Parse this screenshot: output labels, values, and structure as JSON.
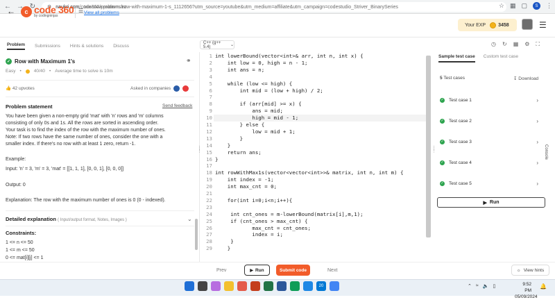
{
  "browser": {
    "url_host": "naukri.com",
    "url_path": "/code360/problems/row-with-maximum-1-s_1112656?utm_source=youtube&utm_medium=affiliate&utm_campaign=codestudio_Striver_BinarySeries",
    "profile_initial": "S"
  },
  "header": {
    "logo_main": "code 360",
    "logo_sub": "by codingninjas",
    "list_label": "Interview problem list",
    "list_link": "View all problems",
    "exp_label": "Your EXP",
    "exp_value": "3458"
  },
  "left_tabs": [
    "Problem",
    "Submissions",
    "Hints & solutions",
    "Discuss"
  ],
  "problem": {
    "title": "Row with Maximum 1's",
    "difficulty": "Easy",
    "score": "40/40",
    "avg_time": "Average time to solve is 10m",
    "upvotes": "42 upvotes",
    "asked_in": "Asked in companies",
    "statement_heading": "Problem statement",
    "feedback": "Send feedback",
    "statement_lines": [
      "You have been given a non-empty grid 'mat' with 'n' rows and 'm' columns",
      "consisting of only 0s and 1s. All the rows are sorted in ascending order.",
      "Your task is to find the index of the row with the maximum number of ones.",
      "Note: If two rows have the same number of ones, consider the one with a",
      "smaller index. If there's no row with at least 1 zero, return -1."
    ],
    "example_label": "Example:",
    "input": "Input: 'n' = 3, 'm' = 3, 'mat' = [[1, 1, 1], [0, 0, 1], [0, 0, 0]]",
    "output": "Output: 0",
    "explanation": "Explanation: The row with the maximum number of ones is 0 (0 - indexed).",
    "detailed_heading": "Detailed explanation",
    "detailed_sub": "( Input/output format, Notes, Images )",
    "constraints_heading": "Constraints:",
    "constraints": [
      "1 <= n <= 50",
      "1 <= m <= 50",
      "0 <= mat[i][j] <= 1"
    ]
  },
  "editor": {
    "language": "C++ (g++ 5.4)",
    "lines": [
      "int lowerBound(vector<int>& arr, int n, int x) {",
      "    int low = 0, high = n - 1;",
      "    int ans = n;",
      "",
      "    while (low <= high) {",
      "        int mid = (low + high) / 2;",
      "",
      "        if (arr[mid] >= x) {",
      "            ans = mid;",
      "            high = mid - 1;",
      "        } else {",
      "            low = mid + 1;",
      "        }",
      "    }",
      "    return ans;",
      "}",
      "",
      "int rowWithMax1s(vector<vector<int>>& matrix, int n, int m) {",
      "    int index = -1;",
      "    int max_cnt = 0;",
      "",
      "    for(int i=0;i<n;i++){",
      "",
      "     int cnt_ones = m-lowerBound(matrix[i],m,1);",
      "     if (cnt_ones > max_cnt) {",
      "            max_cnt = cnt_ones;",
      "            index = i;",
      "     }",
      "    }"
    ]
  },
  "right_panel": {
    "tabs": [
      "Sample test case",
      "Custom test case"
    ],
    "count_num": "5",
    "count_label": "Test cases",
    "download": "Download",
    "test_cases": [
      "Test case 1",
      "Test case 2",
      "Test case 3",
      "Test case 4",
      "Test case 5"
    ],
    "run": "Run",
    "console": "Console"
  },
  "bottom": {
    "prev": "Prev",
    "run": "Run",
    "submit": "Submit code",
    "next": "Next",
    "hints": "View hints"
  },
  "taskbar": {
    "time": "9:52 PM",
    "date": "05/09/2024",
    "badge": "20"
  }
}
